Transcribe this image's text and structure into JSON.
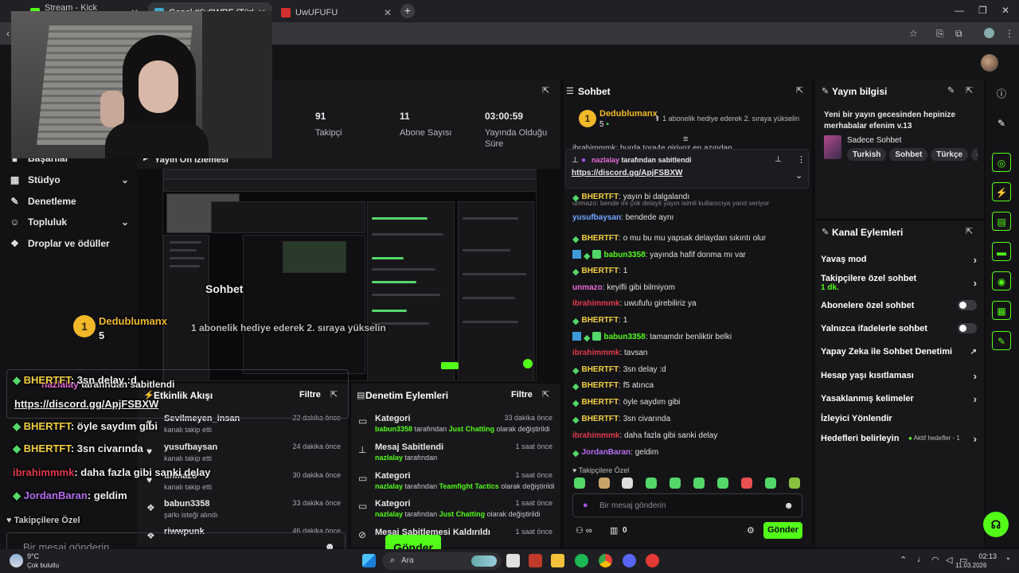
{
  "browser": {
    "tabs": [
      {
        "title": "Stream - Kick Dashboard",
        "color": "#53fc18",
        "active": false
      },
      {
        "title": "Genel #6v9WRF (Türkçe) - Garti...",
        "color": "#3fa7c9",
        "active": true
      },
      {
        "title": "UwUFUFU",
        "color": "#d32f2f",
        "active": false
      }
    ],
    "new_tab": "+"
  },
  "nav": {
    "items": [
      {
        "label": "Başarılar",
        "icon": "trophy-icon",
        "chevron": false
      },
      {
        "label": "Stüdyo",
        "icon": "studio-icon",
        "chevron": true
      },
      {
        "label": "Denetleme",
        "icon": "hammer-icon",
        "chevron": false
      },
      {
        "label": "Topluluk",
        "icon": "people-icon",
        "chevron": true
      },
      {
        "label": "Droplar ve ödüller",
        "icon": "gift-icon",
        "chevron": false
      }
    ]
  },
  "stats": [
    {
      "value": "91",
      "label": "Takipçi"
    },
    {
      "value": "11",
      "label": "Abone Sayısı"
    },
    {
      "value": "03:00:59",
      "label": "Yayında Olduğu Süre"
    }
  ],
  "preview": {
    "title": "Yayın Ön İzlemesi"
  },
  "overlay": {
    "chat_title": "Sohbet",
    "top_user": "Dedublumanx",
    "top_rank": "1",
    "top_count": "5",
    "gift_text": "1 abonelik hediye ederek 2. sıraya yükselin",
    "pinned_by": "nazlalay",
    "pinned_suffix": "tarafından sabitlendi",
    "pinned_link": "https://discord.gg/ApjFSBXW",
    "messages": [
      {
        "user": "BHERTFT",
        "text": ": 3sn delay :d",
        "color": "#f5d142"
      },
      {
        "user": "BHERTFT",
        "text": ": öyle saydım gibi",
        "color": "#f5d142"
      },
      {
        "user": "BHERTFT",
        "text": ": 3sn civarında",
        "color": "#f5d142"
      },
      {
        "user": "ibrahimmmk",
        "text": ": daha fazla gibi sanki delay",
        "color": "#e0394d"
      },
      {
        "user": "JordanBaran",
        "text": ": geldim",
        "color": "#b46cf0"
      }
    ],
    "followers_only": "Takipçilere Özel",
    "input_placeholder": "Bir mesaj gönderin",
    "send_label": "Gönder"
  },
  "activity": {
    "title": "Etkinlik Akışı",
    "filter": "Filtre",
    "items": [
      {
        "name": "Sevilmeyen_insan",
        "sub": "kanalı takip etti",
        "time": "22 dakika önce",
        "icon": "heart-icon"
      },
      {
        "name": "yusufbaysan",
        "sub": "kanalı takip etti",
        "time": "24 dakika önce",
        "icon": "heart-icon"
      },
      {
        "name": "unmazo",
        "sub": "kanalı takip etti",
        "time": "30 dakika önce",
        "icon": "heart-icon"
      },
      {
        "name": "babun3358",
        "sub": "şarkı isteği alındı",
        "time": "33 dakika önce",
        "icon": "gift-icon"
      },
      {
        "name": "riwwpunk",
        "sub": "",
        "time": "46 dakika önce",
        "icon": "gift-icon"
      }
    ]
  },
  "modlog": {
    "title": "Denetim Eylemleri",
    "filter": "Filtre",
    "items": [
      {
        "name": "Kategori",
        "user": "babun3358",
        "mid": "tarafından",
        "cat": "Just Chatting",
        "end": "olarak değiştirildi",
        "time": "33 dakika önce",
        "icon": "category-icon"
      },
      {
        "name": "Mesaj Sabitlendi",
        "user": "nazlalay",
        "mid": "tarafından",
        "cat": "",
        "end": "",
        "time": "1 saat önce",
        "icon": "pin-icon"
      },
      {
        "name": "Kategori",
        "user": "nazlalay",
        "mid": "tarafından",
        "cat": "Teamfight Tactics",
        "end": "olarak değiştirildi",
        "time": "1 saat önce",
        "icon": "category-icon"
      },
      {
        "name": "Kategori",
        "user": "nazlalay",
        "mid": "tarafından",
        "cat": "Just Chatting",
        "end": "olarak değiştirildi",
        "time": "1 saat önce",
        "icon": "category-icon"
      },
      {
        "name": "Mesaj Sabitlemesi Kaldırıldı",
        "user": "",
        "mid": "",
        "cat": "",
        "end": "",
        "time": "1 saat önce",
        "icon": "unpin-icon"
      }
    ]
  },
  "chat": {
    "title": "Sohbet",
    "top_user": "Dedublumanx",
    "top_rank": "1",
    "top_count": "5",
    "gift_text": "1 abonelik hediye ederek 2. sıraya yükselin",
    "partial_line": "ibrahimmmk: burda tora4e giriyoz en azından",
    "pinned_by": "nazlalay",
    "pinned_suffix": "tarafından sabitlendi",
    "pinned_link": "https://discord.gg/ApjFSBXW",
    "messages": [
      {
        "user": "BHERTFT",
        "text": ": yayın bi dalgalandı",
        "color": "#f5d142",
        "badge": "diamond"
      },
      {
        "reply": "unmazo: bende mi çok delayli yayın isimli kullanıcıya yanıt veriyor",
        "user": "yusufbaysan",
        "text": ": bendede aynı",
        "color": "#6fa8ff",
        "badge": ""
      },
      {
        "user": "BHERTFT",
        "text": ": o mu bu mu yapsak delaydan sıkıntı olur",
        "color": "#f5d142",
        "badge": "diamond"
      },
      {
        "user": "babun3358",
        "text": ": yayında hafif donma mı var",
        "color": "#53fc18",
        "badge": "triple"
      },
      {
        "user": "BHERTFT",
        "text": ": 1",
        "color": "#f5d142",
        "badge": "diamond"
      },
      {
        "user": "unmazo",
        "text": ": keyifli gibi bilmiyom",
        "color": "#e86ad8",
        "badge": ""
      },
      {
        "user": "ibrahimmmk",
        "text": ": uwufufu girebiliriz ya",
        "color": "#e0394d",
        "badge": ""
      },
      {
        "user": "BHERTFT",
        "text": ": 1",
        "color": "#f5d142",
        "badge": "diamond"
      },
      {
        "user": "babun3358",
        "text": ": tamamdır benliktir belki",
        "color": "#53fc18",
        "badge": "triple"
      },
      {
        "user": "ibrahimmmk",
        "text": ": tavsan",
        "color": "#e0394d",
        "badge": ""
      },
      {
        "user": "BHERTFT",
        "text": ": 3sn delay :d",
        "color": "#f5d142",
        "badge": "diamond"
      },
      {
        "user": "BHERTFT",
        "text": ": f5 atınca",
        "color": "#f5d142",
        "badge": "diamond"
      },
      {
        "user": "BHERTFT",
        "text": ": öyle saydım gibi",
        "color": "#f5d142",
        "badge": "diamond"
      },
      {
        "user": "BHERTFT",
        "text": ": 3sn civarında",
        "color": "#f5d142",
        "badge": "diamond"
      },
      {
        "user": "ibrahimmmk",
        "text": ": daha fazla gibi sanki delay",
        "color": "#e0394d",
        "badge": ""
      },
      {
        "user": "JordanBaran",
        "text": ": geldim",
        "color": "#b46cf0",
        "badge": "diamond"
      }
    ],
    "followers_only": "Takipçilere Özel",
    "input_placeholder": "Bir mesaj gönderin",
    "points": "0",
    "send_label": "Gönder"
  },
  "stream_info": {
    "title": "Yayın bilgisi",
    "stream_title": "Yeni bir yayın gecesinden hepinize merhabalar efenim v.13",
    "category": "Sadece Sohbet",
    "tags": [
      "Turkish",
      "Sohbet",
      "Türkçe",
      "chi"
    ]
  },
  "channel_actions": {
    "title": "Kanal Eylemleri",
    "rows": [
      {
        "label": "Yavaş mod",
        "control": "chevron"
      },
      {
        "label": "Takipçilere özel sohbet",
        "sub": "1 dk.",
        "control": "chevron"
      },
      {
        "label": "Abonelere özel sohbet",
        "control": "toggle"
      },
      {
        "label": "Yalnızca ifadelerle sohbet",
        "control": "toggle"
      },
      {
        "label": "Yapay Zeka ile Sohbet Denetimi",
        "control": "external"
      },
      {
        "label": "Hesap yaşı kısıtlaması",
        "control": "chevron"
      },
      {
        "label": "Yasaklanmış kelimeler",
        "control": "chevron"
      },
      {
        "label": "İzleyici Yönlendir",
        "control": "none"
      },
      {
        "label": "Hedefleri belirleyin",
        "control": "chevron",
        "status": "Aktif hedefler - 1"
      }
    ]
  },
  "taskbar": {
    "weather_temp": "9°C",
    "weather_desc": "Çok bulutlu",
    "search": "Ara",
    "time": "02:13",
    "date": "11.03.2026"
  },
  "colors": {
    "accent": "#53fc18",
    "bg": "#0e0e10",
    "panel": "#18181b"
  }
}
